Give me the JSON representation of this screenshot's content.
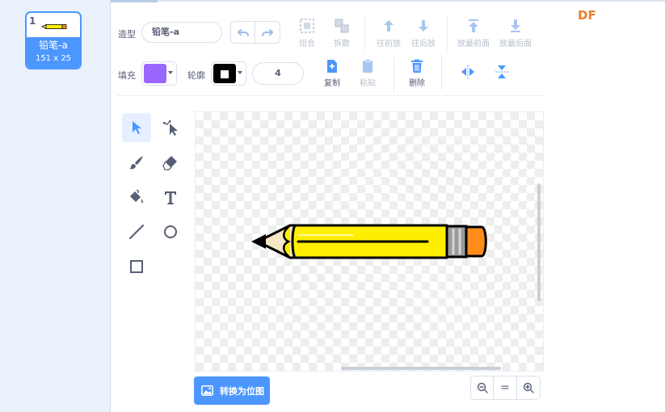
{
  "costume": {
    "number": "1",
    "name": "铅笔-a",
    "size": "151 x 25"
  },
  "toolbar": {
    "costume_label": "造型",
    "costume_name": "铅笔-a",
    "group": "组合",
    "ungroup": "拆散",
    "forward": "往前放",
    "backward": "往后放",
    "front": "放最前面",
    "back": "放最后面",
    "fill_label": "填充",
    "fill_color": "#9966ff",
    "outline_label": "轮廓",
    "outline_color": "#000000",
    "outline_width": "4",
    "copy": "复制",
    "paste": "粘贴",
    "delete": "删除"
  },
  "tools": [
    "select",
    "reshape",
    "brush",
    "eraser",
    "fill",
    "text",
    "line",
    "circle",
    "rectangle"
  ],
  "canvas": {
    "convert_button": "转换为位图"
  },
  "zoom": {
    "out": "zoom-out",
    "reset": "=",
    "in": "zoom-in"
  },
  "brand": {
    "logo": "DF",
    "accent": "#4c97ff",
    "logo_color": "#ef7c2f"
  }
}
